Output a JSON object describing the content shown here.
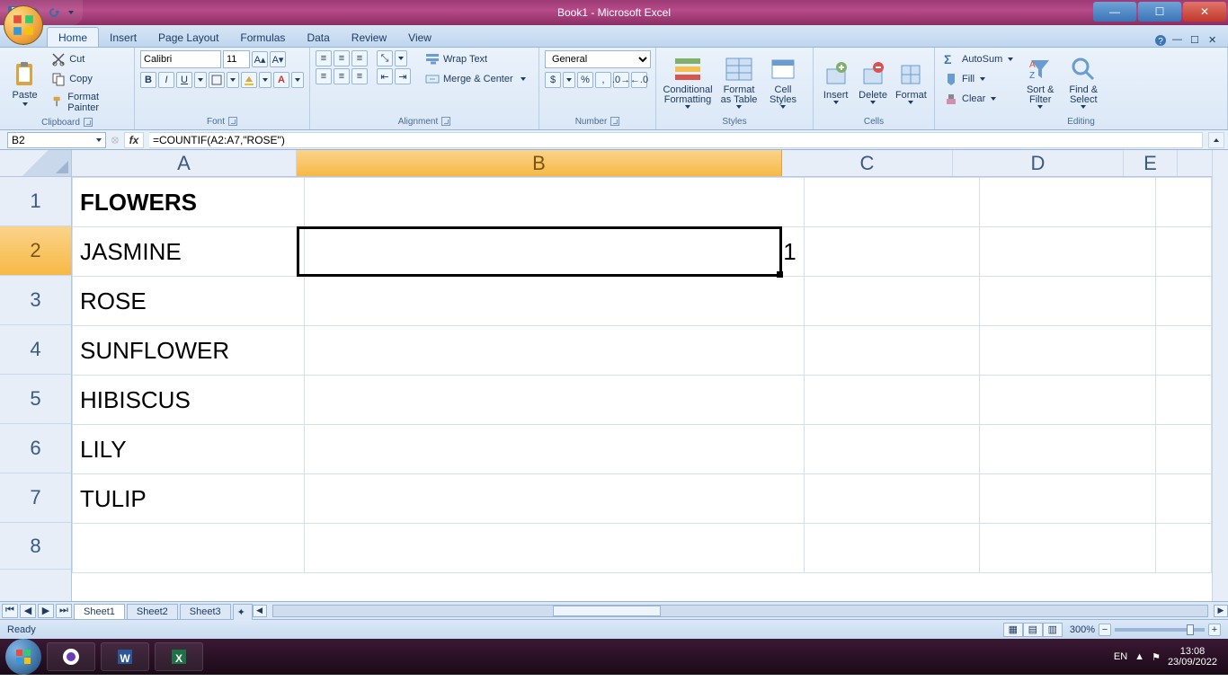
{
  "window": {
    "title": "Book1 - Microsoft Excel"
  },
  "qat": {
    "save": "save-icon",
    "undo": "undo-icon",
    "redo": "redo-icon"
  },
  "tabs": [
    "Home",
    "Insert",
    "Page Layout",
    "Formulas",
    "Data",
    "Review",
    "View"
  ],
  "active_tab": "Home",
  "ribbon": {
    "clipboard": {
      "title": "Clipboard",
      "paste": "Paste",
      "cut": "Cut",
      "copy": "Copy",
      "format_painter": "Format Painter"
    },
    "font": {
      "title": "Font",
      "name": "Calibri",
      "size": "11"
    },
    "alignment": {
      "title": "Alignment",
      "wrap": "Wrap Text",
      "merge": "Merge & Center"
    },
    "number": {
      "title": "Number",
      "format": "General"
    },
    "styles": {
      "title": "Styles",
      "cond": "Conditional\nFormatting",
      "table": "Format\nas Table",
      "cell": "Cell\nStyles"
    },
    "cells": {
      "title": "Cells",
      "insert": "Insert",
      "delete": "Delete",
      "format": "Format"
    },
    "editing": {
      "title": "Editing",
      "autosum": "AutoSum",
      "fill": "Fill",
      "clear": "Clear",
      "sort": "Sort &\nFilter",
      "find": "Find &\nSelect"
    }
  },
  "formula_bar": {
    "name_box": "B2",
    "formula": "=COUNTIF(A2:A7,\"ROSE\")"
  },
  "columns": [
    "A",
    "B",
    "C",
    "D",
    "E"
  ],
  "rows": [
    "1",
    "2",
    "3",
    "4",
    "5",
    "6",
    "7",
    "8"
  ],
  "sheet": {
    "A1": "FLOWERS",
    "A2": "JASMINE",
    "A3": "ROSE",
    "A4": "SUNFLOWER",
    "A5": "HIBISCUS",
    "A6": "LILY",
    "A7": "TULIP",
    "B2": "1"
  },
  "active_cell": "B2",
  "sheet_tabs": [
    "Sheet1",
    "Sheet2",
    "Sheet3"
  ],
  "active_sheet": "Sheet1",
  "status": {
    "left": "Ready",
    "zoom": "300%"
  },
  "tray": {
    "lang": "EN",
    "time": "13:08",
    "date": "23/09/2022"
  },
  "chart_data": null
}
